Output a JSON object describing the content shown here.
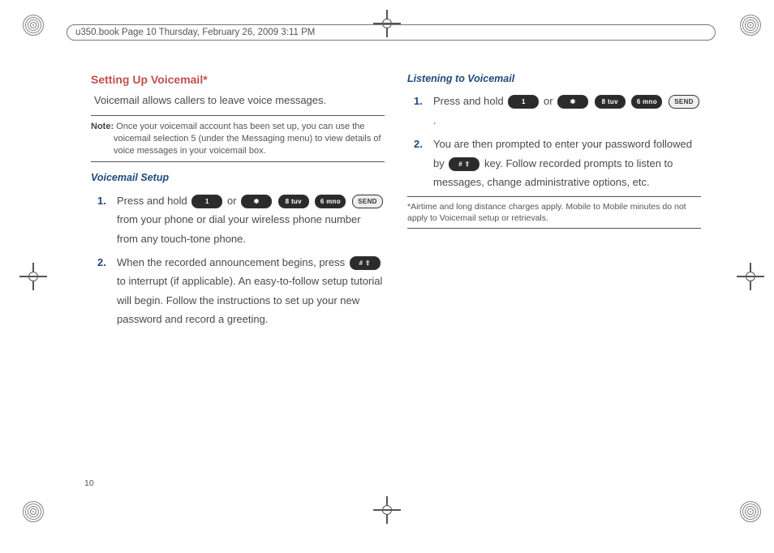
{
  "header": {
    "info": "u350.book  Page 10  Thursday, February 26, 2009  3:11 PM"
  },
  "page_number": "10",
  "left": {
    "h2": "Setting Up Voicemail*",
    "intro": "Voicemail allows callers to leave voice messages.",
    "note_label": "Note:",
    "note_text": "Once your voicemail account has been set up, you can use the voicemail selection 5 (under the Messaging menu) to view details of voice messages in your voicemail box.",
    "h3": "Voicemail Setup",
    "step1_a": "Press and hold ",
    "step1_or": " or ",
    "step1_b": " from your phone or dial your wireless phone number from any touch-tone phone.",
    "step2_a": "When the recorded announcement begins, press ",
    "step2_b": " to interrupt (if applicable). An easy-to-follow setup tutorial will begin. Follow the instructions to set up your new password and record a greeting."
  },
  "right": {
    "h3": "Listening to Voicemail",
    "step1_a": "Press and hold ",
    "step1_or": " or ",
    "step1_end": " .",
    "step2_a": "You are then prompted to enter your password followed by ",
    "step2_b": " key. Follow recorded prompts to listen to messages, change administrative options, etc.",
    "footnote": "*Airtime and long distance charges apply. Mobile to Mobile minutes do not apply to Voicemail setup or retrievals."
  },
  "keys": {
    "one": "1",
    "star": "✱",
    "eight": "8 tuv",
    "six": "6 mno",
    "send": "SEND",
    "pound": "# ⇧"
  }
}
